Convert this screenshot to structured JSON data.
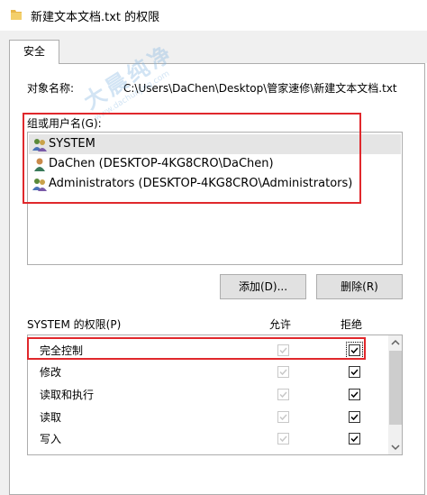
{
  "window": {
    "title": "新建文本文档.txt 的权限"
  },
  "tabs": [
    {
      "label": "安全"
    }
  ],
  "object": {
    "label": "对象名称:",
    "value": "C:\\Users\\DaChen\\Desktop\\管家速修\\新建文本文档.txt"
  },
  "groups": {
    "label": "组或用户名(G):",
    "items": [
      {
        "name": "SYSTEM",
        "icon": "users-group-icon",
        "selected": true
      },
      {
        "name": "DaChen (DESKTOP-4KG8CRO\\DaChen)",
        "icon": "user-icon",
        "selected": false
      },
      {
        "name": "Administrators (DESKTOP-4KG8CRO\\Administrators)",
        "icon": "users-group-icon",
        "selected": false
      }
    ]
  },
  "buttons": {
    "add": "添加(D)...",
    "remove": "删除(R)"
  },
  "permissions": {
    "label": "SYSTEM 的权限(P)",
    "allow_header": "允许",
    "deny_header": "拒绝",
    "rows": [
      {
        "name": "完全控制",
        "allow": true,
        "deny": true
      },
      {
        "name": "修改",
        "allow": true,
        "deny": true
      },
      {
        "name": "读取和执行",
        "allow": true,
        "deny": true
      },
      {
        "name": "读取",
        "allow": true,
        "deny": true
      },
      {
        "name": "写入",
        "allow": true,
        "deny": true
      }
    ]
  },
  "watermark": {
    "main": "大晨纯净",
    "sub": "www.dachunjing.com"
  },
  "colors": {
    "highlight": "#e0282c",
    "selected_row": "#e5e5e5",
    "button_bg": "#e1e1e1"
  }
}
